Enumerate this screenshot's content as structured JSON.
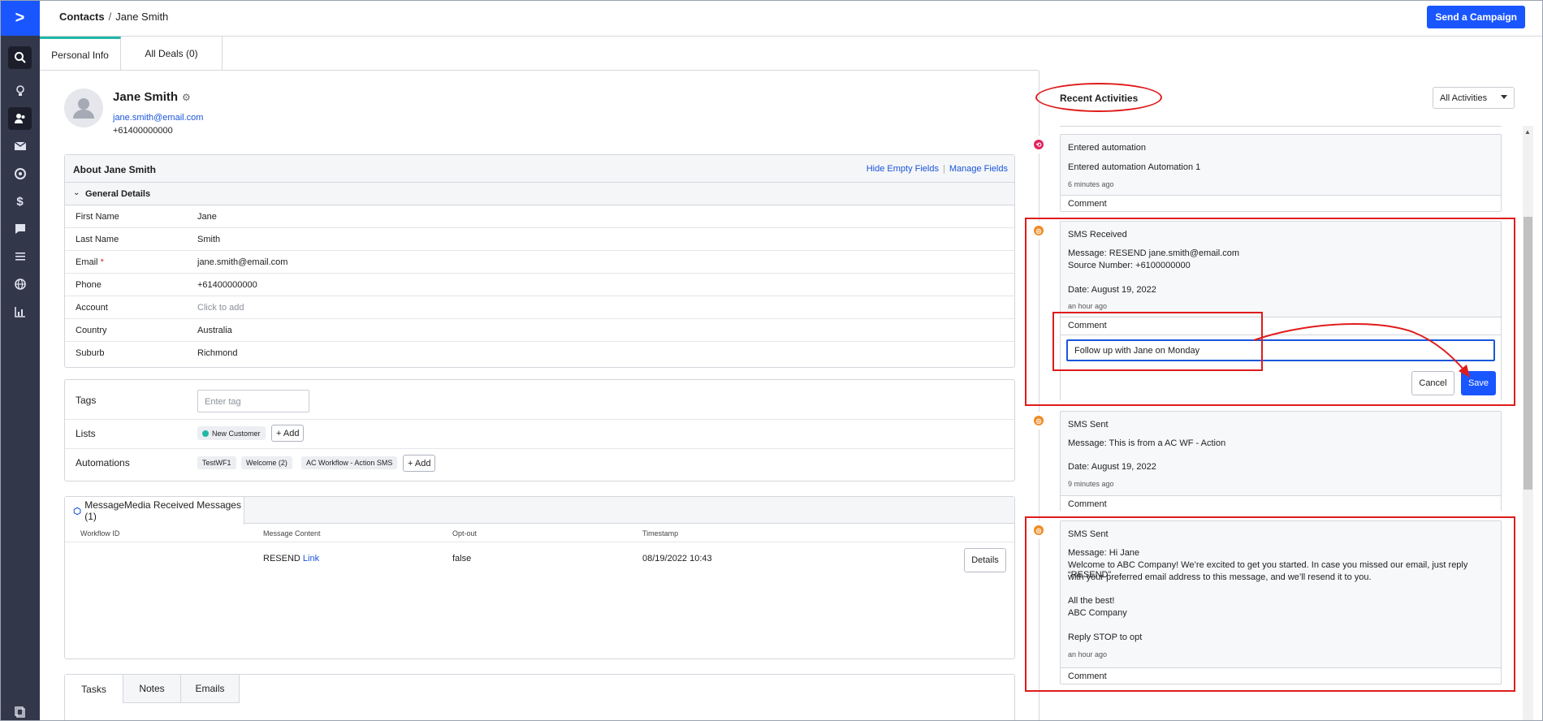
{
  "nav": {
    "logo": ">",
    "icons": [
      "search-icon",
      "lightbulb-icon",
      "contacts-icon",
      "email-icon",
      "automation-icon",
      "dollar-icon",
      "chat-icon",
      "list-icon",
      "globe-icon",
      "reports-icon"
    ]
  },
  "topbar": {
    "breadcrumb_root": "Contacts",
    "breadcrumb_sep": "/",
    "breadcrumb_current": "Jane Smith",
    "send_campaign": "Send a Campaign"
  },
  "tabs": {
    "personal": "Personal Info",
    "deals": "All Deals (0)"
  },
  "contact": {
    "name": "Jane Smith",
    "email": "jane.smith@email.com",
    "phone": "+61400000000"
  },
  "about": {
    "title": "About Jane Smith",
    "hide_empty": "Hide Empty Fields",
    "divider": "|",
    "manage": "Manage Fields",
    "section": "General Details",
    "fields": [
      {
        "label": "First Name",
        "value": "Jane"
      },
      {
        "label": "Last Name",
        "value": "Smith"
      },
      {
        "label": "Email",
        "value": "jane.smith@email.com",
        "required": "*"
      },
      {
        "label": "Phone",
        "value": "+61400000000"
      },
      {
        "label": "Account",
        "value": "Click to add"
      },
      {
        "label": "Country",
        "value": "Australia"
      },
      {
        "label": "Suburb",
        "value": "Richmond"
      }
    ]
  },
  "tagsblock": {
    "tags_label": "Tags",
    "tag_placeholder": "Enter tag",
    "lists_label": "Lists",
    "list_chip": "New Customer",
    "add": "+ Add",
    "automations_label": "Automations",
    "automations": [
      "TestWF1",
      "Welcome  (2)",
      "AC Workflow - Action SMS"
    ]
  },
  "messagemedia": {
    "tab": "MessageMedia Received Messages (1)",
    "columns": [
      "Workflow ID",
      "Message Content",
      "Opt-out",
      "Timestamp"
    ],
    "row": {
      "content": "RESEND",
      "link": "Link",
      "optout": "false",
      "timestamp": "08/19/2022 10:43",
      "details": "Details"
    }
  },
  "bottom_tabs": [
    "Tasks",
    "Notes",
    "Emails"
  ],
  "activities": {
    "title": "Recent Activities",
    "filter": "All Activities",
    "comment_label": "Comment",
    "items": [
      {
        "title": "Entered automation",
        "line1": "Entered automation Automation 1",
        "ago": "6 minutes ago"
      },
      {
        "title": "SMS Received",
        "line1": "Message: RESEND jane.smith@email.com",
        "line2": "Source Number: +6100000000",
        "line3": "Date: August 19, 2022",
        "ago": "an hour ago"
      },
      {
        "title": "SMS Sent",
        "line1": "Message: This is from a AC WF - Action",
        "line2": "Date: August 19, 2022",
        "ago": "9 minutes ago"
      },
      {
        "title": "SMS Sent",
        "line1": "Message: Hi Jane",
        "line2": "Welcome to ABC Company! We’re excited to get you started. In case you missed our email, just reply “RESEND”",
        "line3": "with your preferred email address to this message, and we’ll resend it to you.",
        "line4": "All the best!",
        "line5": "ABC Company",
        "line6": "Reply STOP to opt",
        "ago": "an hour ago"
      }
    ],
    "comment_input": "Follow up with Jane on Monday",
    "cancel": "Cancel",
    "save": "Save"
  },
  "colors": {
    "accent": "#1a56ff",
    "rail": "#33374a",
    "annotation": "#e01b1b",
    "teal": "#21b7a8"
  }
}
